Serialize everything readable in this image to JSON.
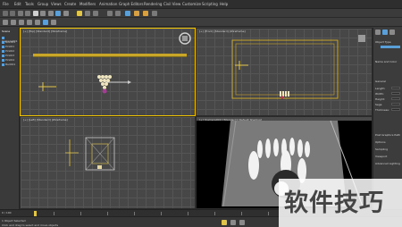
{
  "menubar": {
    "items": [
      "File",
      "Edit",
      "Tools",
      "Group",
      "Views",
      "Create",
      "Modifiers",
      "Animation",
      "Graph Editors",
      "Rendering",
      "Civil View",
      "Customize",
      "Scripting",
      "Help"
    ]
  },
  "scene_explorer": {
    "title": "Scene",
    "items": [
      "Camera001",
      "Box001",
      "Pin001",
      "Pin002",
      "Pin003",
      "Pin004",
      "Ball001"
    ]
  },
  "viewports": {
    "top": {
      "label": "[+] [Top] [Standard] [Wireframe]"
    },
    "front": {
      "label": "[+] [Front] [Standard] [Wireframe]"
    },
    "left": {
      "label": "[+] [Left] [Standard] [Wireframe]"
    },
    "perspective": {
      "label": "[+] [Camera001] [Standard] [Default Shading]"
    }
  },
  "command_panel": {
    "object_type": "Object Type",
    "name_color": "Name and Color",
    "general": "General",
    "fields": [
      "Length:",
      "Width:",
      "Height:",
      "Segs:",
      "Thickness:"
    ],
    "rollouts": [
      "Post Graphics Path",
      "Options",
      "Sampling",
      "Viewport",
      "Advanced Lighting"
    ]
  },
  "timeline": {
    "frame_counter": "0 / 100"
  },
  "status": {
    "selected": "1 Object Selected",
    "prompt": "Click and drag to select and move objects"
  },
  "watermark": {
    "text": "软件技巧"
  },
  "colors": {
    "active_border": "#f0c400",
    "viewport_bg": "#474747",
    "accent_blue": "#5a9fd8"
  }
}
